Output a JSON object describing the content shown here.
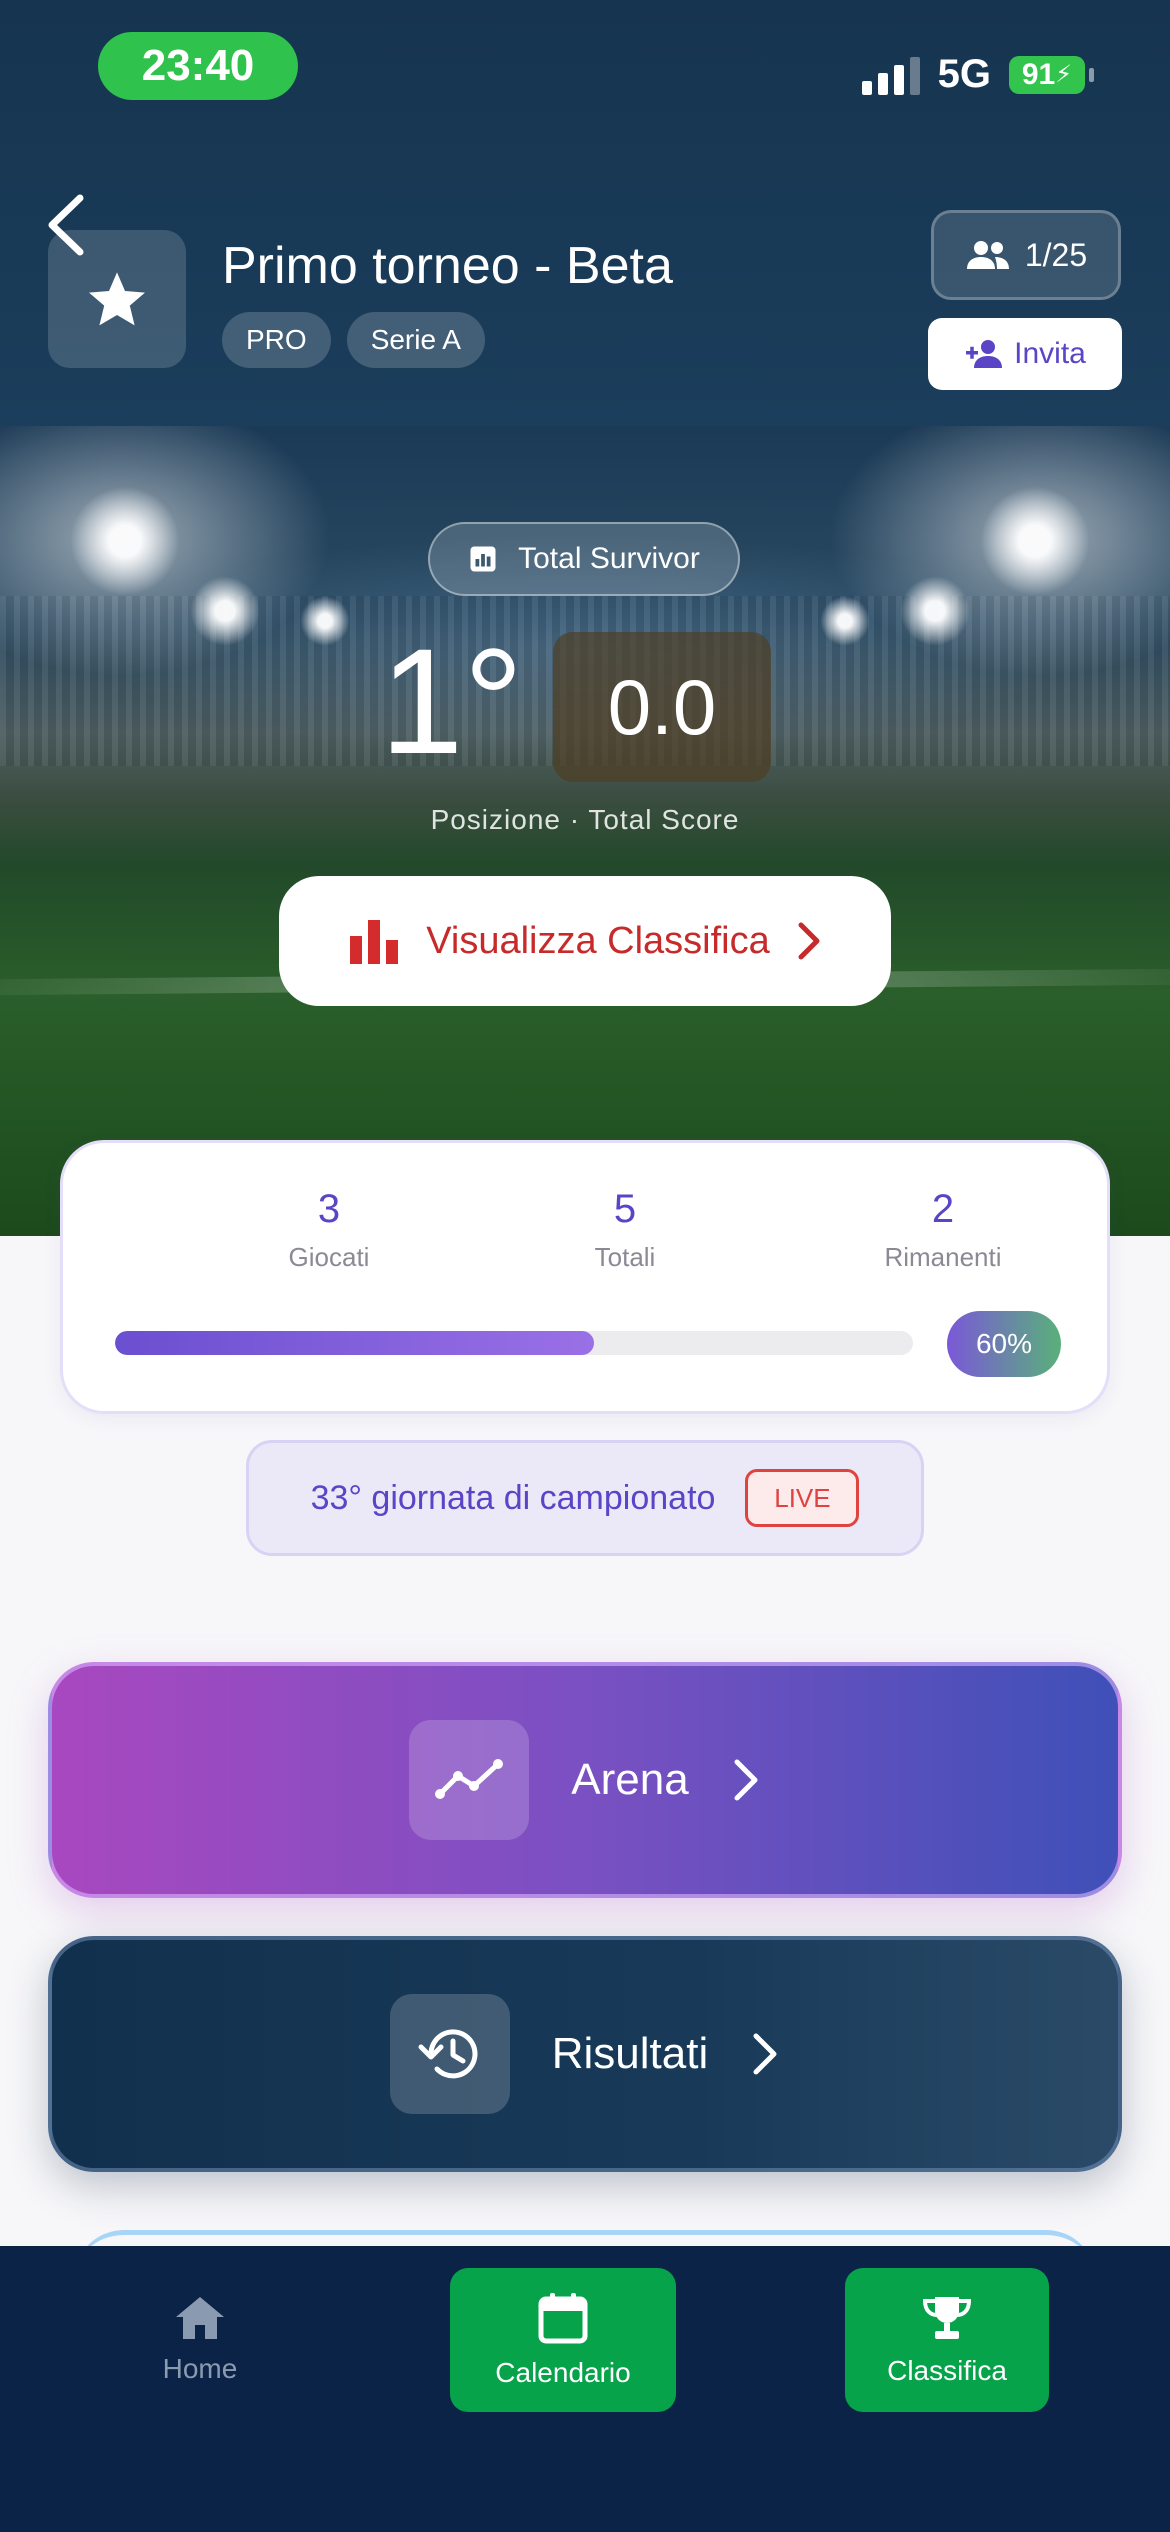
{
  "status_bar": {
    "time": "23:40",
    "network": "5G",
    "battery": "91"
  },
  "header": {
    "title": "Primo torneo - Beta",
    "chips": [
      "PRO",
      "Serie A"
    ],
    "members": "1/25",
    "invite_label": "Invita"
  },
  "hero": {
    "mode": "Total Survivor",
    "position": "1°",
    "score": "0.0",
    "caption": "Posizione · Total Score",
    "ranking_button": "Visualizza Classifica"
  },
  "stats": {
    "played": {
      "value": "3",
      "label": "Giocati"
    },
    "total": {
      "value": "5",
      "label": "Totali"
    },
    "remaining": {
      "value": "2",
      "label": "Rimanenti"
    },
    "progress_label": "60%",
    "progress_fraction": 0.6
  },
  "matchday": {
    "text": "33° giornata di campionato",
    "live": "LIVE"
  },
  "actions": {
    "arena": "Arena",
    "results": "Risultati"
  },
  "nav": {
    "home": "Home",
    "calendar": "Calendario",
    "ranking": "Classifica"
  },
  "icons": {
    "back": "chevron-left-icon",
    "logo": "star-icon",
    "members": "people-icon",
    "invite": "person-add-icon",
    "mode": "bar-chart-icon",
    "ranking": "bar-chart-icon",
    "arena": "trend-line-icon",
    "results": "history-clock-icon",
    "home": "house-icon",
    "calendar": "calendar-icon",
    "ranking_nav": "trophy-icon"
  },
  "colors": {
    "accent_purple": "#5b44c6",
    "live_red": "#e0433f",
    "nav_green": "#06a34a",
    "header_navy": "#16344f"
  }
}
